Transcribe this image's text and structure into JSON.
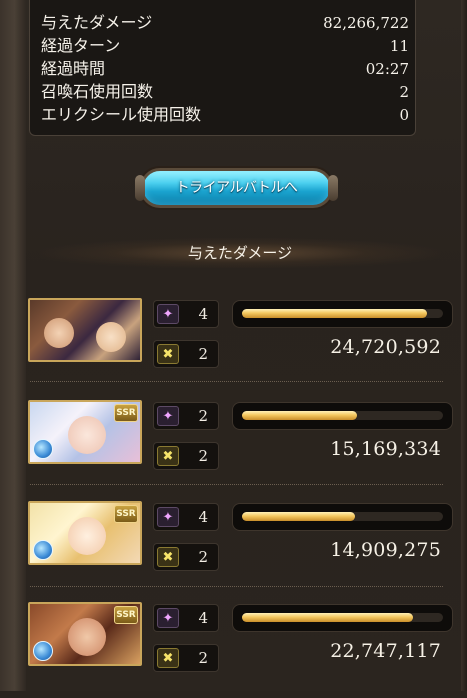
{
  "stats": [
    {
      "label": "与えたダメージ",
      "value": "82,266,722"
    },
    {
      "label": "経過ターン",
      "value": "11"
    },
    {
      "label": "経過時間",
      "value": "02:27"
    },
    {
      "label": "召喚石使用回数",
      "value": "2"
    },
    {
      "label": "エリクシール使用回数",
      "value": "0"
    }
  ],
  "trial_button": {
    "label": "トライアルバトルへ"
  },
  "section_title": "与えたダメージ",
  "characters": [
    {
      "portrait": "dual-character-portrait",
      "rarity": "",
      "element": "",
      "ability_count": "4",
      "buff_count": "2",
      "damage": "24,720,592",
      "damage_ratio": 0.92
    },
    {
      "portrait": "character-portrait",
      "rarity": "SSR",
      "element": "water-element-icon",
      "ability_count": "2",
      "buff_count": "2",
      "damage": "15,169,334",
      "damage_ratio": 0.57
    },
    {
      "portrait": "character-portrait",
      "rarity": "SSR",
      "element": "water-element-icon",
      "ability_count": "4",
      "buff_count": "2",
      "damage": "14,909,275",
      "damage_ratio": 0.56
    },
    {
      "portrait": "character-portrait",
      "rarity": "SSR",
      "element": "water-element-icon",
      "ability_count": "4",
      "buff_count": "2",
      "damage": "22,747,117",
      "damage_ratio": 0.85
    }
  ],
  "colors": {
    "accent_gold": "#f4c860",
    "button_cyan": "#4cd0ef",
    "panel_bg": "#1a1714"
  }
}
